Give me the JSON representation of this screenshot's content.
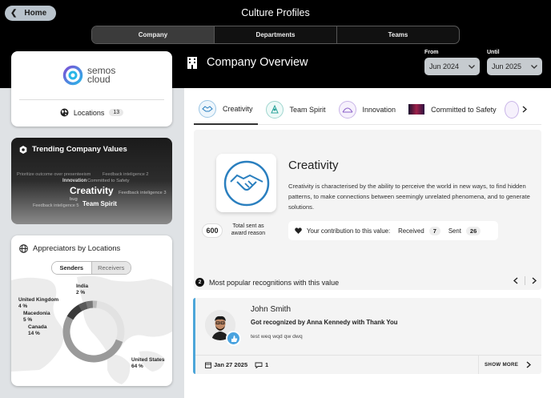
{
  "header": {
    "home_label": "Home",
    "title": "Culture Profiles",
    "tabs": [
      "Company",
      "Departments",
      "Teams"
    ],
    "active_tab": "Company",
    "overview_title": "Company Overview",
    "from_label": "From",
    "from_value": "Jun 2024",
    "until_label": "Until",
    "until_value": "Jun 2025"
  },
  "sidebar": {
    "logo_line1": "semos",
    "logo_line2": "cloud",
    "locations_label": "Locations",
    "locations_count": "13",
    "trending_title": "Trending Company Values",
    "word_cloud": [
      "Prioritize outcome over presenteeism",
      "Feedback inteligence 2",
      "Innovation",
      "Committed to Safety",
      "Creativity",
      "Feedback inteligence 3",
      "bug",
      "Feedback inteligence 5",
      "Team Spirit"
    ],
    "appreciators_title": "Appreciators by Locations",
    "toggle_on": "Senders",
    "toggle_off": "Receivers",
    "map_labels": [
      {
        "country": "India",
        "pct": "2 %"
      },
      {
        "country": "United Kingdom",
        "pct": "4 %"
      },
      {
        "country": "Macedonia",
        "pct": "5 %"
      },
      {
        "country": "Canada",
        "pct": "14 %"
      },
      {
        "country": "United States",
        "pct": "64 %"
      }
    ]
  },
  "values_tabs": [
    "Creativity",
    "Team Spirit",
    "Innovation",
    "Committed to Safety"
  ],
  "active_value": "Creativity",
  "value_detail": {
    "title": "Creativity",
    "description": "Creativity is characterised by the ability to perceive the world in new ways, to find hidden patterns, to make connections between seemingly unrelated phenomena, and to generate solutions.",
    "total_count": "600",
    "total_label": "Total sent as award reason",
    "contribution_label": "Your contribution to this value:",
    "received_label": "Received",
    "received_count": "7",
    "sent_label": "Sent",
    "sent_count": "26"
  },
  "popular": {
    "number": "2",
    "title": "Most popular recognitions with this value"
  },
  "recognition": {
    "name": "John Smith",
    "line": "Got recognized by Anna Kennedy with Thank You",
    "message": "test weq wqd qw dwq",
    "date": "Jan 27 2025",
    "comments": "1",
    "show_more": "SHOW MORE"
  },
  "colors": {
    "accent_blue": "#2a7fbf",
    "card_border": "#4da6d9",
    "background_dark": "#000000"
  }
}
